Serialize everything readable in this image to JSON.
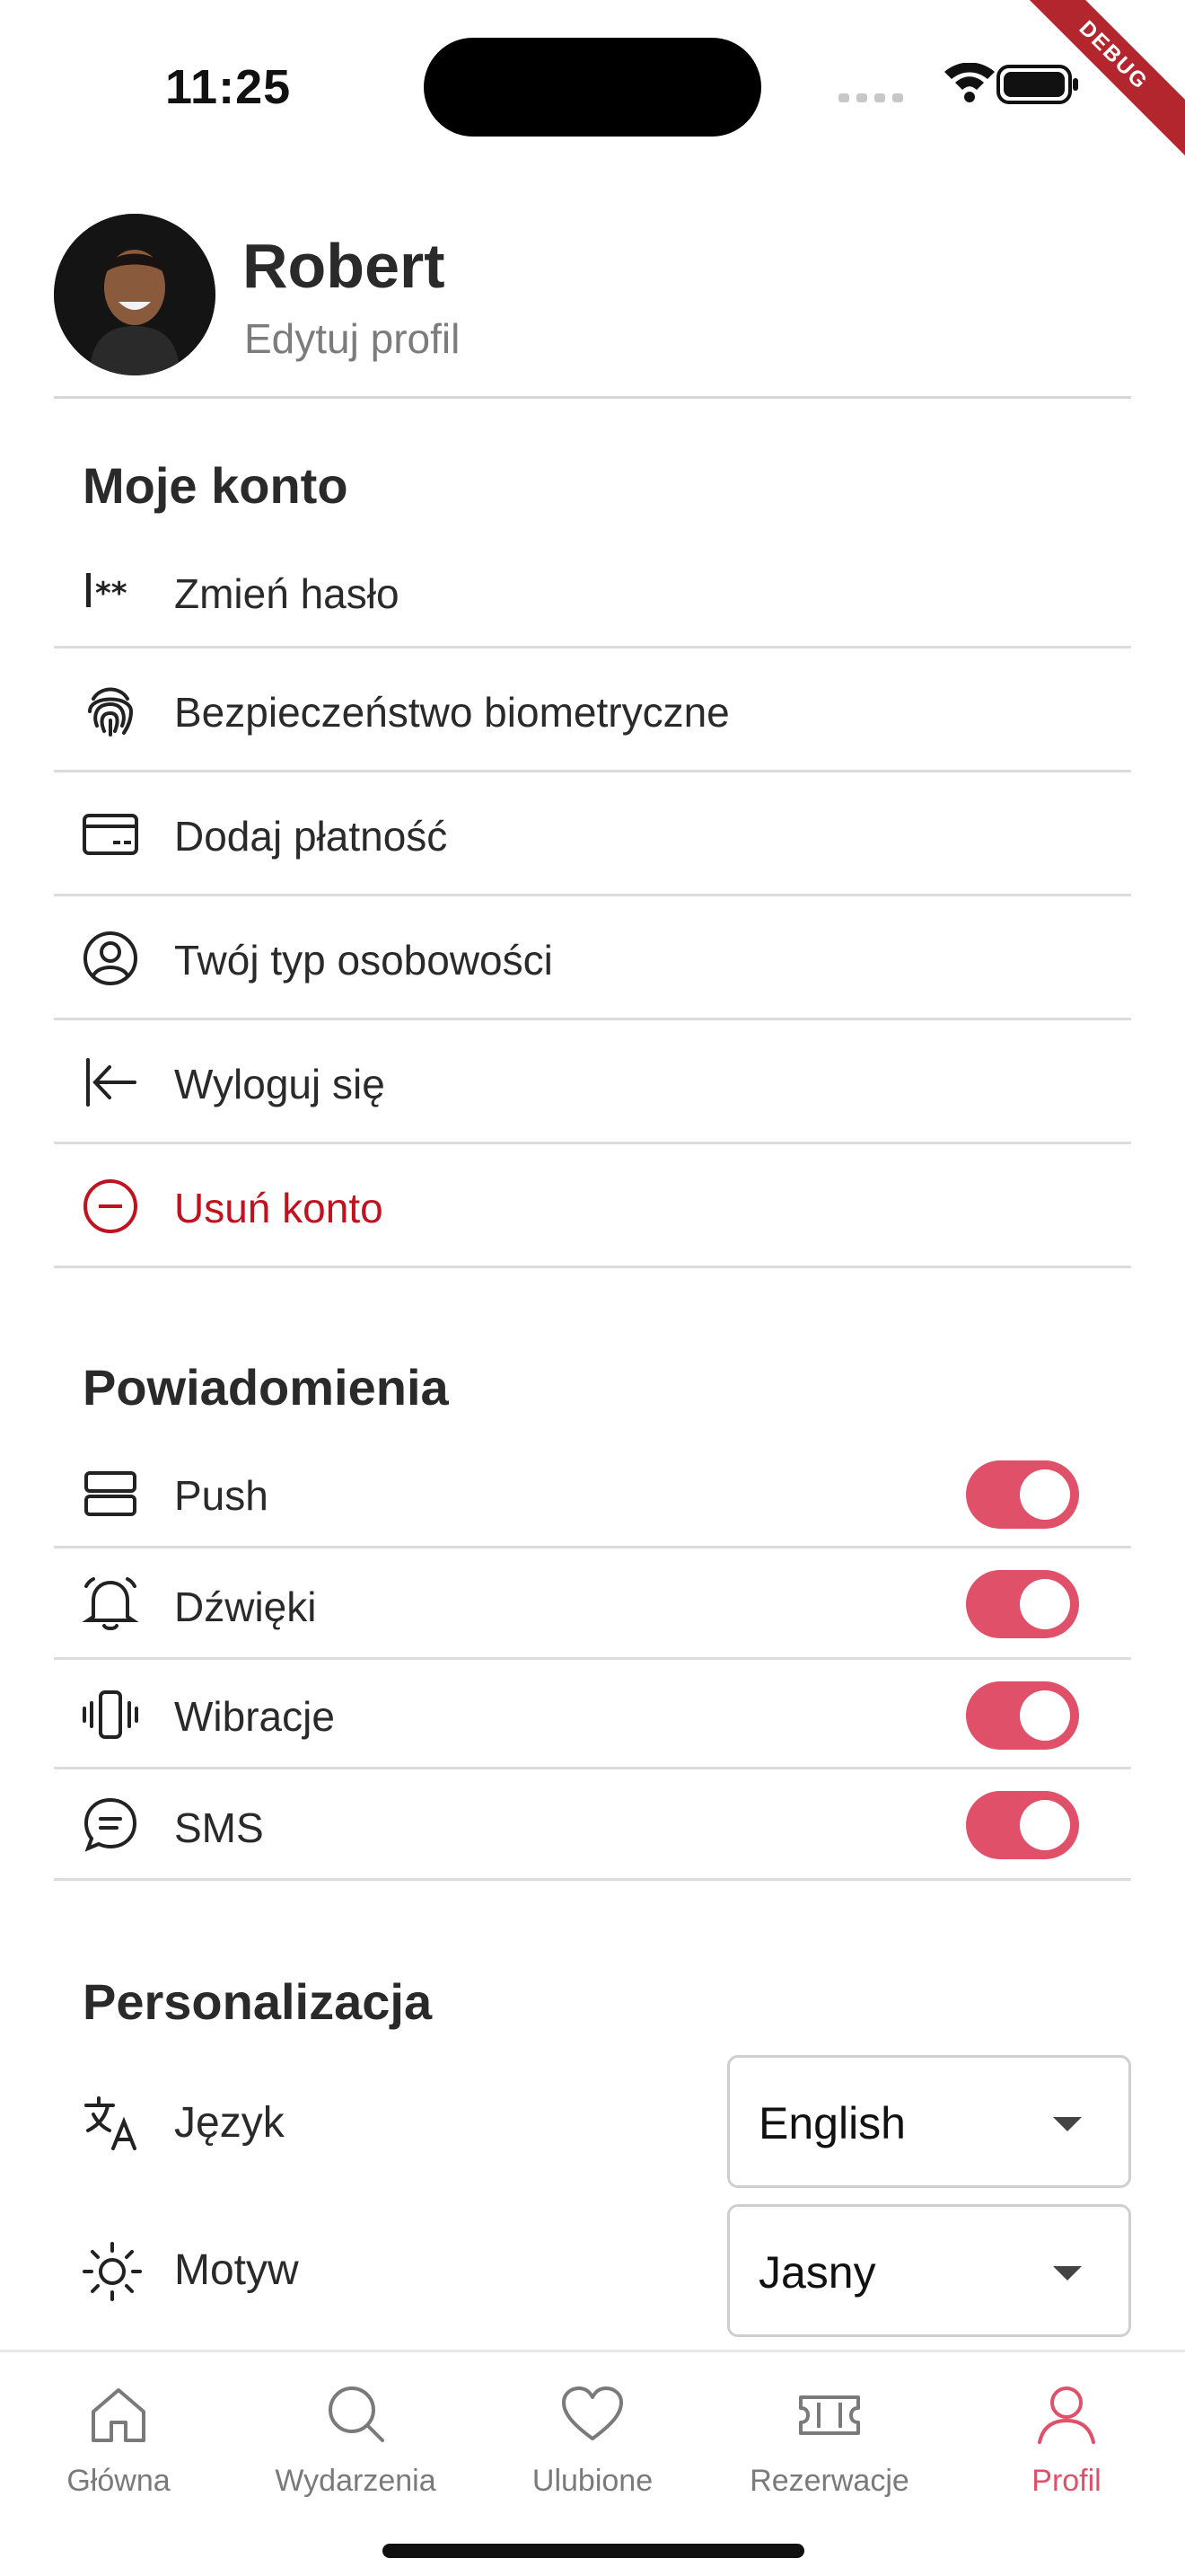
{
  "status_bar": {
    "time": "11:25",
    "debug_label": "DEBUG"
  },
  "profile": {
    "name": "Robert",
    "edit_label": "Edytuj profil"
  },
  "account": {
    "title": "Moje konto",
    "items": [
      {
        "label": "Zmień hasło",
        "icon": "password-icon"
      },
      {
        "label": "Bezpieczeństwo biometryczne",
        "icon": "fingerprint-icon"
      },
      {
        "label": "Dodaj płatność",
        "icon": "credit-card-icon"
      },
      {
        "label": "Twój typ osobowości",
        "icon": "account-circle-icon"
      },
      {
        "label": "Wyloguj się",
        "icon": "logout-icon"
      },
      {
        "label": "Usuń konto",
        "icon": "remove-circle-icon"
      }
    ]
  },
  "notifications": {
    "title": "Powiadomienia",
    "items": [
      {
        "label": "Push",
        "icon": "notifications-stack-icon",
        "enabled": true
      },
      {
        "label": "Dźwięki",
        "icon": "bell-icon",
        "enabled": true
      },
      {
        "label": "Wibracje",
        "icon": "vibration-icon",
        "enabled": true
      },
      {
        "label": "SMS",
        "icon": "chat-bubble-icon",
        "enabled": true
      }
    ]
  },
  "personalization": {
    "title": "Personalizacja",
    "language": {
      "label": "Język",
      "value": "English",
      "icon": "translate-icon"
    },
    "theme": {
      "label": "Motyw",
      "value": "Jasny",
      "icon": "sun-icon"
    }
  },
  "bottom_nav": {
    "items": [
      {
        "label": "Główna",
        "icon": "home-icon",
        "active": false
      },
      {
        "label": "Wydarzenia",
        "icon": "search-icon",
        "active": false
      },
      {
        "label": "Ulubione",
        "icon": "heart-icon",
        "active": false
      },
      {
        "label": "Rezerwacje",
        "icon": "ticket-icon",
        "active": false
      },
      {
        "label": "Profil",
        "icon": "person-icon",
        "active": true
      }
    ]
  },
  "colors": {
    "accent": "#e0506a",
    "danger": "#c1121f",
    "divider": "#dcdcdc"
  }
}
